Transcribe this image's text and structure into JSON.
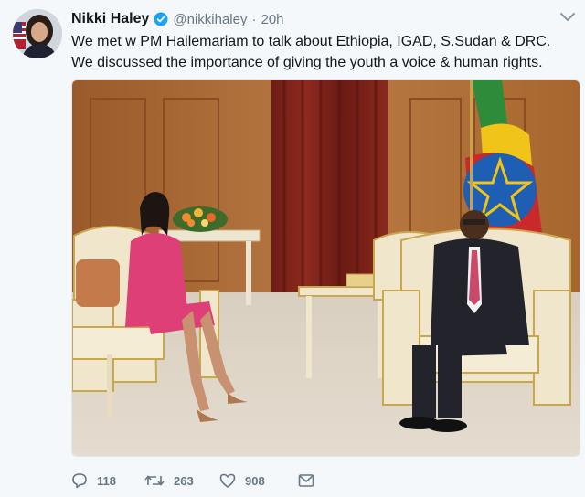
{
  "tweet": {
    "author_name": "Nikki Haley",
    "author_handle": "@nikkihaley",
    "separator": "·",
    "time": "20h",
    "text": "We met w PM Hailemariam to talk about Ethiopia, IGAD, S.Sudan & DRC. We discussed the importance of giving the youth a voice & human rights."
  },
  "actions": {
    "replies": "118",
    "retweets": "263",
    "likes": "908"
  },
  "icons": {
    "verified": "verified-badge-icon",
    "caret": "chevron-down-icon",
    "reply": "reply-icon",
    "retweet": "retweet-icon",
    "like": "heart-icon",
    "dm": "envelope-icon"
  },
  "colors": {
    "background": "#f5f8fa",
    "verified_blue": "#1da1f2",
    "secondary_text": "#657786"
  }
}
